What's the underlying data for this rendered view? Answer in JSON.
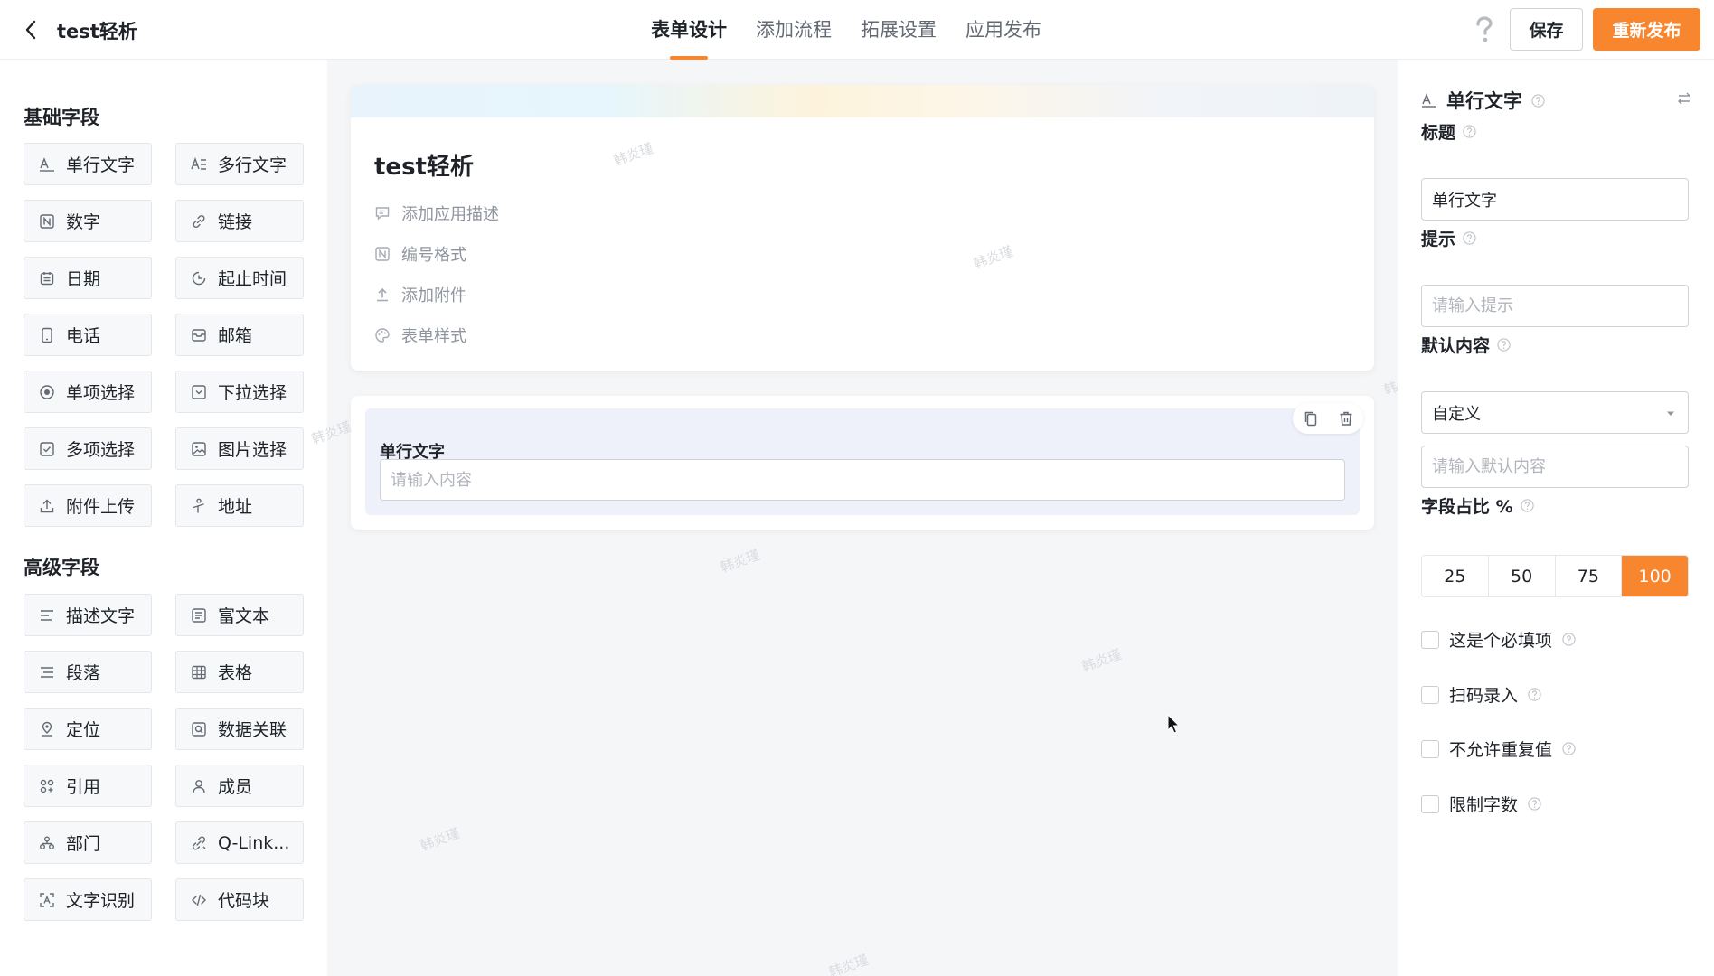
{
  "header": {
    "app_title": "test轻析",
    "tabs": [
      {
        "label": "表单设计",
        "active": true
      },
      {
        "label": "添加流程",
        "active": false
      },
      {
        "label": "拓展设置",
        "active": false
      },
      {
        "label": "应用发布",
        "active": false
      }
    ],
    "save_label": "保存",
    "publish_label": "重新发布",
    "accent_color": "#f7862f"
  },
  "palette": {
    "basic_title": "基础字段",
    "basic_fields": [
      {
        "label": "单行文字",
        "icon": "single-line-text-icon"
      },
      {
        "label": "多行文字",
        "icon": "multi-line-text-icon"
      },
      {
        "label": "数字",
        "icon": "number-icon"
      },
      {
        "label": "链接",
        "icon": "link-icon"
      },
      {
        "label": "日期",
        "icon": "calendar-icon"
      },
      {
        "label": "起止时间",
        "icon": "time-range-icon"
      },
      {
        "label": "电话",
        "icon": "phone-icon"
      },
      {
        "label": "邮箱",
        "icon": "mailbox-icon"
      },
      {
        "label": "单项选择",
        "icon": "radio-icon"
      },
      {
        "label": "下拉选择",
        "icon": "dropdown-icon"
      },
      {
        "label": "多项选择",
        "icon": "checkbox-icon"
      },
      {
        "label": "图片选择",
        "icon": "image-icon"
      },
      {
        "label": "附件上传",
        "icon": "upload-icon"
      },
      {
        "label": "地址",
        "icon": "address-icon"
      }
    ],
    "advanced_title": "高级字段",
    "advanced_fields": [
      {
        "label": "描述文字",
        "icon": "description-icon"
      },
      {
        "label": "富文本",
        "icon": "rich-text-icon"
      },
      {
        "label": "段落",
        "icon": "paragraph-icon"
      },
      {
        "label": "表格",
        "icon": "table-icon"
      },
      {
        "label": "定位",
        "icon": "location-icon"
      },
      {
        "label": "数据关联",
        "icon": "data-link-icon"
      },
      {
        "label": "引用",
        "icon": "reference-icon"
      },
      {
        "label": "成员",
        "icon": "member-icon"
      },
      {
        "label": "部门",
        "icon": "department-icon"
      },
      {
        "label": "Q-Link...",
        "icon": "q-link-icon"
      },
      {
        "label": "文字识别",
        "icon": "ocr-icon"
      },
      {
        "label": "代码块",
        "icon": "code-icon"
      }
    ]
  },
  "form": {
    "title": "test轻析",
    "meta_actions": [
      {
        "label": "添加应用描述",
        "icon": "comment-icon"
      },
      {
        "label": "编号格式",
        "icon": "numbering-icon"
      },
      {
        "label": "添加附件",
        "icon": "upload-icon"
      },
      {
        "label": "表单样式",
        "icon": "palette-icon"
      }
    ],
    "field": {
      "label": "单行文字",
      "placeholder": "请输入内容"
    },
    "watermark": "韩炎瑾"
  },
  "props": {
    "field_type": "单行文字",
    "title_label": "标题",
    "title_value": "单行文字",
    "hint_label": "提示",
    "hint_placeholder": "请输入提示",
    "default_label": "默认内容",
    "default_select": "自定义",
    "default_placeholder": "请输入默认内容",
    "width_label": "字段占比 %",
    "width_options": [
      "25",
      "50",
      "75",
      "100"
    ],
    "width_selected": "100",
    "checks": [
      {
        "label": "这是个必填项",
        "checked": false
      },
      {
        "label": "扫码录入",
        "checked": false
      },
      {
        "label": "不允许重复值",
        "checked": false
      },
      {
        "label": "限制字数",
        "checked": false
      }
    ]
  }
}
